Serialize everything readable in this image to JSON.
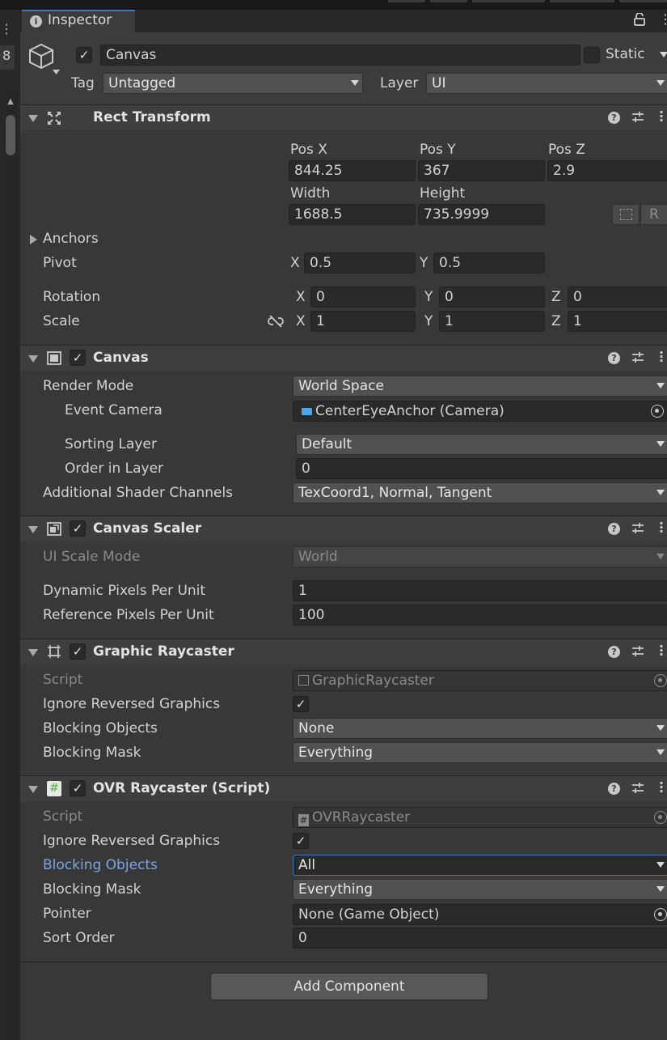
{
  "window": {
    "tab_title": "Inspector",
    "left_panel_number": "8"
  },
  "header": {
    "object_name": "Canvas",
    "active": true,
    "static_label": "Static",
    "tag_label": "Tag",
    "tag_value": "Untagged",
    "layer_label": "Layer",
    "layer_value": "UI"
  },
  "rect_transform": {
    "title": "Rect Transform",
    "pos_x_label": "Pos X",
    "pos_x": "844.25",
    "pos_y_label": "Pos Y",
    "pos_y": "367",
    "pos_z_label": "Pos Z",
    "pos_z": "2.9",
    "width_label": "Width",
    "width": "1688.5",
    "height_label": "Height",
    "height": "735.9999",
    "raw_button": "R",
    "anchors_label": "Anchors",
    "pivot_label": "Pivot",
    "pivot_x": "0.5",
    "pivot_y": "0.5",
    "rotation_label": "Rotation",
    "rot_x": "0",
    "rot_y": "0",
    "rot_z": "0",
    "scale_label": "Scale",
    "scale_x": "1",
    "scale_y": "1",
    "scale_z": "1",
    "x": "X",
    "y": "Y",
    "z": "Z"
  },
  "canvas": {
    "title": "Canvas",
    "enabled": true,
    "render_mode_label": "Render Mode",
    "render_mode": "World Space",
    "event_camera_label": "Event Camera",
    "event_camera": "CenterEyeAnchor (Camera)",
    "sorting_layer_label": "Sorting Layer",
    "sorting_layer": "Default",
    "order_label": "Order in Layer",
    "order": "0",
    "shader_label": "Additional Shader Channels",
    "shader": "TexCoord1, Normal, Tangent"
  },
  "canvas_scaler": {
    "title": "Canvas Scaler",
    "enabled": true,
    "ui_scale_mode_label": "UI Scale Mode",
    "ui_scale_mode": "World",
    "dynamic_label": "Dynamic Pixels Per Unit",
    "dynamic": "1",
    "reference_label": "Reference Pixels Per Unit",
    "reference": "100"
  },
  "graphic_raycaster": {
    "title": "Graphic Raycaster",
    "enabled": true,
    "script_label": "Script",
    "script": "GraphicRaycaster",
    "ignore_label": "Ignore Reversed Graphics",
    "ignore": true,
    "blocking_objects_label": "Blocking Objects",
    "blocking_objects": "None",
    "blocking_mask_label": "Blocking Mask",
    "blocking_mask": "Everything"
  },
  "ovr_raycaster": {
    "title": "OVR Raycaster (Script)",
    "enabled": true,
    "script_label": "Script",
    "script": "OVRRaycaster",
    "ignore_label": "Ignore Reversed Graphics",
    "ignore": true,
    "blocking_objects_label": "Blocking Objects",
    "blocking_objects": "All",
    "blocking_mask_label": "Blocking Mask",
    "blocking_mask": "Everything",
    "pointer_label": "Pointer",
    "pointer": "None (Game Object)",
    "sort_order_label": "Sort Order",
    "sort_order": "0"
  },
  "add_component": "Add Component",
  "colors": {
    "background": "#383838",
    "accent": "#3a79bb",
    "highlight_label": "#7aa6e4",
    "script_icon_green": "#6fbf5a",
    "camera_icon_blue": "#49a6e8"
  }
}
